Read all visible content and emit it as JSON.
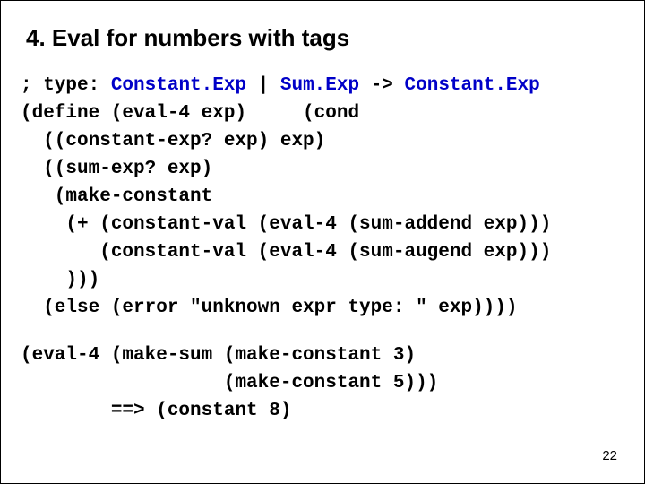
{
  "title": "4. Eval for numbers with tags",
  "code1": {
    "l0a": "; type: ",
    "l0b": "Constant.Exp",
    "l0c": " | ",
    "l0d": "Sum.Exp",
    "l0e": " -> ",
    "l0f": "Constant.Exp",
    "l1": "(define (eval-4 exp)     (cond",
    "l2": "  ((constant-exp? exp) exp)",
    "l3": "  ((sum-exp? exp)",
    "l4": "   (make-constant",
    "l5": "    (+ (constant-val (eval-4 (sum-addend exp)))",
    "l6": "       (constant-val (eval-4 (sum-augend exp)))",
    "l7": "    )))",
    "l8": "  (else (error \"unknown expr type: \" exp))))"
  },
  "code2": {
    "l0": "(eval-4 (make-sum (make-constant 3)",
    "l1": "                  (make-constant 5)))",
    "l2": "        ==> (constant 8)"
  },
  "page": "22"
}
